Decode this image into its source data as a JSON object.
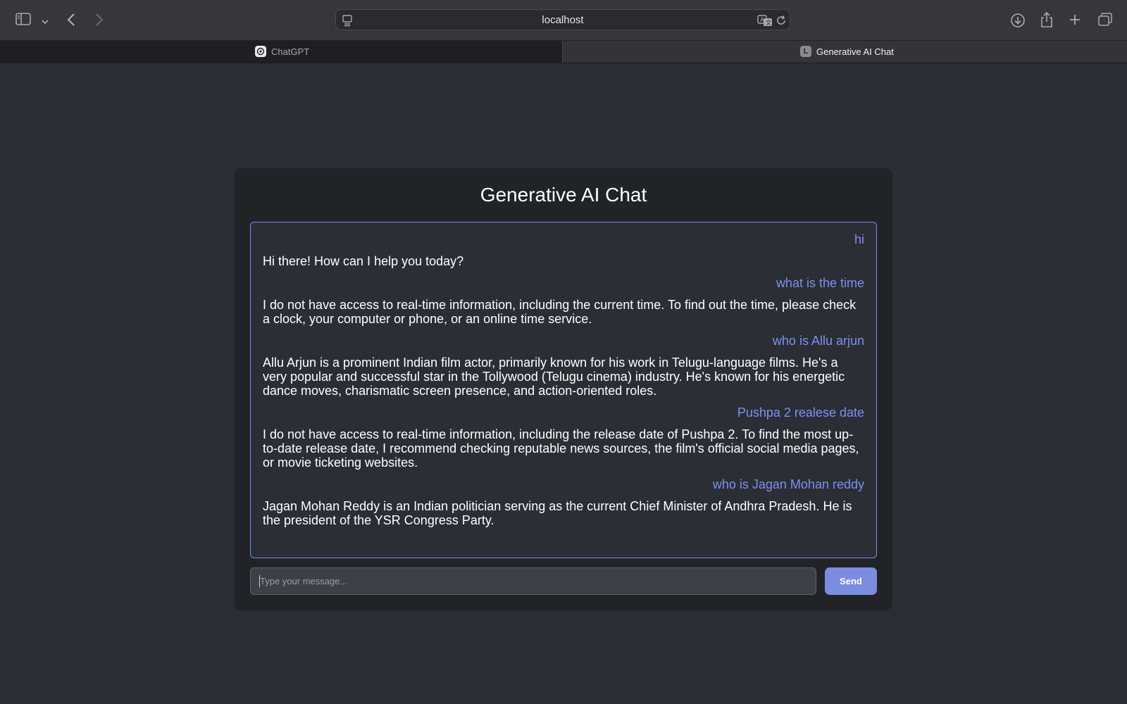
{
  "browser": {
    "address": "localhost",
    "tabs": [
      {
        "label": "ChatGPT",
        "active": false
      },
      {
        "label": "Generative AI Chat",
        "active": true,
        "favicon_letter": "L"
      }
    ]
  },
  "app": {
    "title": "Generative AI Chat",
    "messages": [
      {
        "role": "user",
        "text": "hi"
      },
      {
        "role": "bot",
        "text": "Hi there! How can I help you today?"
      },
      {
        "role": "user",
        "text": "what is the time"
      },
      {
        "role": "bot",
        "text": "I do not have access to real-time information, including the current time. To find out the time, please check a clock, your computer or phone, or an online time service."
      },
      {
        "role": "user",
        "text": "who is Allu arjun"
      },
      {
        "role": "bot",
        "text": "Allu Arjun is a prominent Indian film actor, primarily known for his work in Telugu-language films. He's a very popular and successful star in the Tollywood (Telugu cinema) industry. He's known for his energetic dance moves, charismatic screen presence, and action-oriented roles."
      },
      {
        "role": "user",
        "text": "Pushpa 2 realese date"
      },
      {
        "role": "bot",
        "text": "I do not have access to real-time information, including the release date of Pushpa 2. To find the most up-to-date release date, I recommend checking reputable news sources, the film's official social media pages, or movie ticketing websites."
      },
      {
        "role": "user",
        "text": "who is Jagan Mohan reddy"
      },
      {
        "role": "bot",
        "text": "Jagan Mohan Reddy is an Indian politician serving as the current Chief Minister of Andhra Pradesh. He is the president of the YSR Congress Party."
      }
    ],
    "input_placeholder": "Type your message...",
    "send_label": "Send"
  },
  "colors": {
    "accent": "#7a8de0",
    "user_text": "#7f90ee",
    "page_bg": "#2a2d33",
    "card_bg": "#212327"
  }
}
